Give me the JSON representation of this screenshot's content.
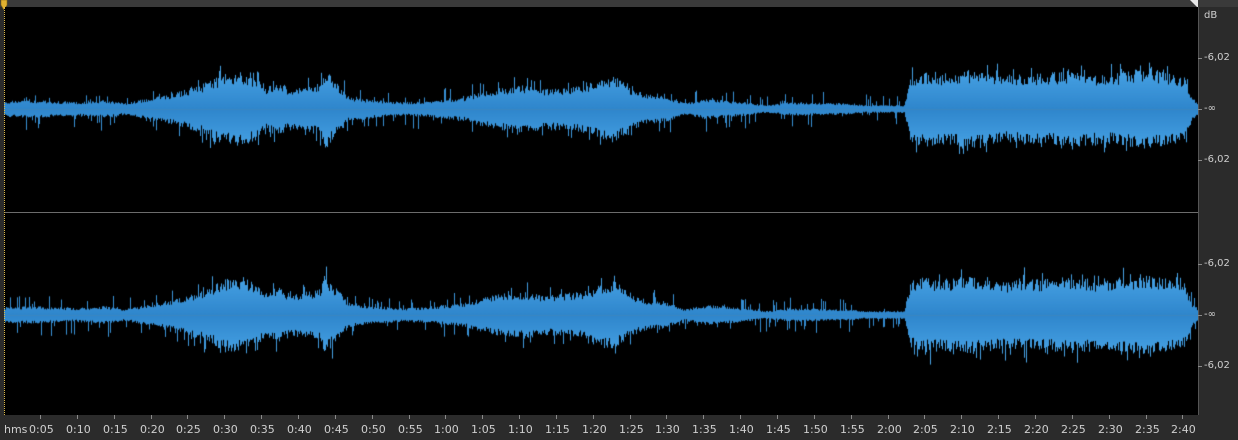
{
  "colors": {
    "waveform": "#4aa6e8",
    "waveform_dark": "#2f86cc",
    "background": "#000000",
    "ruler_bg": "#2b2b2b",
    "playhead": "#e0b030"
  },
  "db_ruler": {
    "unit": "dB",
    "channel_left": [
      "-6,02",
      "-∞",
      "-6,02"
    ],
    "channel_right": [
      "-6,02",
      "-∞",
      "-6,02"
    ]
  },
  "time_ruler": {
    "unit": "hms",
    "labels": [
      "0:05",
      "0:10",
      "0:15",
      "0:20",
      "0:25",
      "0:30",
      "0:35",
      "0:40",
      "0:45",
      "0:50",
      "0:55",
      "1:00",
      "1:05",
      "1:10",
      "1:15",
      "1:20",
      "1:25",
      "1:30",
      "1:35",
      "1:40",
      "1:45",
      "1:50",
      "1:55",
      "2:00",
      "2:05",
      "2:10",
      "2:15",
      "2:20",
      "2:25",
      "2:30",
      "2:35",
      "2:40"
    ]
  },
  "icons": {
    "playhead_marker": "playhead-marker-icon",
    "end_marker": "end-marker-icon"
  }
}
